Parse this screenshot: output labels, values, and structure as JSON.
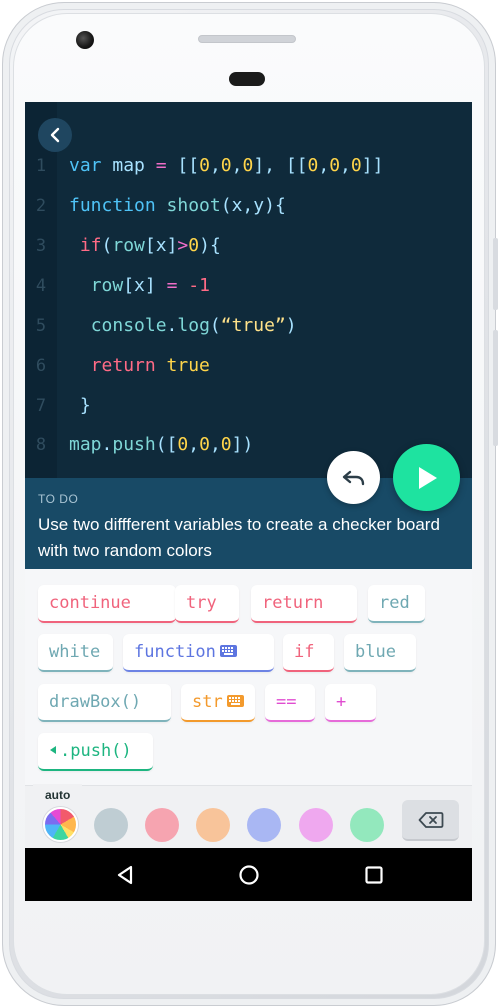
{
  "editor": {
    "lines": [
      {
        "num": "1",
        "parts": [
          [
            "kw",
            "var "
          ],
          [
            "pl",
            "map "
          ],
          [
            "op",
            "= "
          ],
          [
            "pl",
            "[["
          ],
          [
            "num",
            "0"
          ],
          [
            "pl",
            ","
          ],
          [
            "num",
            "0"
          ],
          [
            "pl",
            ","
          ],
          [
            "num",
            "0"
          ],
          [
            "pl",
            "], ["
          ],
          [
            "pl",
            "["
          ],
          [
            "num",
            "0"
          ],
          [
            "pl",
            ","
          ],
          [
            "num",
            "0"
          ],
          [
            "pl",
            ","
          ],
          [
            "num",
            "0"
          ],
          [
            "pl",
            "]]"
          ]
        ]
      },
      {
        "num": "2",
        "parts": [
          [
            "kw",
            "function "
          ],
          [
            "fn",
            "shoot"
          ],
          [
            "pl",
            "("
          ],
          [
            "pl",
            "x"
          ],
          [
            "pl",
            ","
          ],
          [
            "pl",
            "y"
          ],
          [
            "pl",
            "){"
          ]
        ]
      },
      {
        "num": "3",
        "parts": [
          [
            "pl",
            " "
          ],
          [
            "kred",
            "if"
          ],
          [
            "pl",
            "("
          ],
          [
            "fn",
            "row"
          ],
          [
            "pl",
            "["
          ],
          [
            "pl",
            "x"
          ],
          [
            "pl",
            "]"
          ],
          [
            "op",
            ">"
          ],
          [
            "num",
            "0"
          ],
          [
            "pl",
            "){"
          ]
        ]
      },
      {
        "num": "4",
        "parts": [
          [
            "pl",
            "  "
          ],
          [
            "fn",
            "row"
          ],
          [
            "pl",
            "["
          ],
          [
            "pl",
            "x"
          ],
          [
            "pl",
            "] "
          ],
          [
            "op",
            "= "
          ],
          [
            "kred",
            "-1"
          ]
        ]
      },
      {
        "num": "5",
        "parts": [
          [
            "pl",
            "  "
          ],
          [
            "fn",
            "console"
          ],
          [
            "pl",
            "."
          ],
          [
            "fn",
            "log"
          ],
          [
            "pl",
            "("
          ],
          [
            "str",
            "“true”"
          ],
          [
            "pl",
            ")"
          ]
        ]
      },
      {
        "num": "6",
        "parts": [
          [
            "pl",
            "  "
          ],
          [
            "kred",
            "return "
          ],
          [
            "num",
            "true"
          ]
        ]
      },
      {
        "num": "7",
        "parts": [
          [
            "pl",
            " }"
          ]
        ]
      },
      {
        "num": "8",
        "parts": [
          [
            "fn",
            "map"
          ],
          [
            "pl",
            "."
          ],
          [
            "fn",
            "push"
          ],
          [
            "pl",
            "(["
          ],
          [
            "num",
            "0"
          ],
          [
            "pl",
            ","
          ],
          [
            "num",
            "0"
          ],
          [
            "pl",
            ","
          ],
          [
            "num",
            "0"
          ],
          [
            "pl",
            "])"
          ]
        ]
      }
    ]
  },
  "todo": {
    "label": "TO DO",
    "text": "Use two diffferent variables to create a checker board with two random colors"
  },
  "tokens": [
    {
      "label": "continue",
      "color": "red",
      "keyboard": false,
      "arrow": false
    },
    {
      "label": "try",
      "color": "red",
      "keyboard": false,
      "arrow": false
    },
    {
      "label": "return",
      "color": "red",
      "keyboard": false,
      "arrow": false
    },
    {
      "label": "red",
      "color": "teal",
      "keyboard": false,
      "arrow": false
    },
    {
      "label": "white",
      "color": "teal",
      "keyboard": false,
      "arrow": false
    },
    {
      "label": "function",
      "color": "blue",
      "keyboard": true,
      "arrow": false
    },
    {
      "label": "if",
      "color": "red",
      "keyboard": false,
      "arrow": false
    },
    {
      "label": "blue",
      "color": "teal",
      "keyboard": false,
      "arrow": false
    },
    {
      "label": "drawBox()",
      "color": "teal",
      "keyboard": false,
      "arrow": false
    },
    {
      "label": "str",
      "color": "orange",
      "keyboard": true,
      "arrow": false
    },
    {
      "label": "==",
      "color": "pink",
      "keyboard": false,
      "arrow": false
    },
    {
      "label": "+",
      "color": "pink",
      "keyboard": false,
      "arrow": false
    },
    {
      "label": ".push()",
      "color": "green",
      "keyboard": false,
      "arrow": true
    }
  ],
  "palette": {
    "tab_label": "auto",
    "swatches": [
      "#bfcdd3",
      "#f6a4b0",
      "#f8c49a",
      "#a9b7f3",
      "#efa8ef",
      "#93e8bd"
    ]
  },
  "colors": {
    "editor_bg": "#0f2a3b",
    "todo_bg": "#184a66",
    "run_button": "#1ee3a0"
  }
}
